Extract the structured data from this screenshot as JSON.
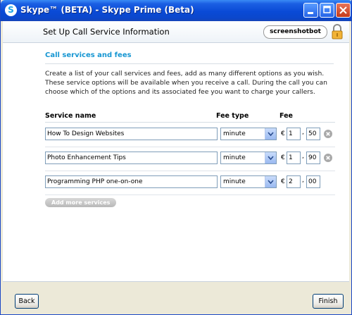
{
  "window": {
    "title": "Skype™ (BETA) - Skype Prime (Beta)",
    "titlebar_gradient": "#0a4ad6"
  },
  "header": {
    "title": "Set Up Call Service Information",
    "badge": "screenshotbot"
  },
  "section": {
    "title": "Call services and fees",
    "description": "Create a list of your call services and fees, add as many different options as you wish. These service options will be available when you receive a call. During the call you can choose which of the options and its associated fee you want to charge your callers.",
    "accent_color": "#1696d2"
  },
  "table": {
    "col_service": "Service name",
    "col_fee_type": "Fee type",
    "col_fee": "Fee",
    "currency": "€",
    "rows": [
      {
        "service": "How To Design Websites",
        "fee_type": "minute",
        "fee_int": "1",
        "fee_dec": "50",
        "removable": true
      },
      {
        "service": "Photo Enhancement Tips",
        "fee_type": "minute",
        "fee_int": "1",
        "fee_dec": "90",
        "removable": true
      },
      {
        "service": "Programming PHP one-on-one",
        "fee_type": "minute",
        "fee_int": "2",
        "fee_dec": "00",
        "removable": false
      }
    ]
  },
  "add_more_label": "Add more services",
  "footer": {
    "back_label": "Back",
    "finish_label": "Finish"
  }
}
